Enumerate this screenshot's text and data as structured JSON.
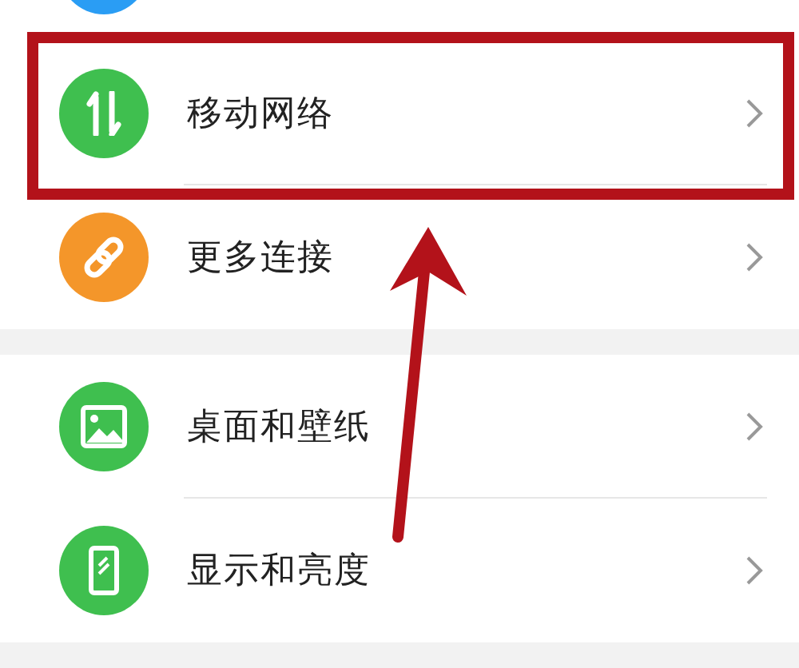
{
  "top_item": {
    "color": "#2a9df4"
  },
  "groups": [
    {
      "items": [
        {
          "kind": "arrows",
          "label": "移动网络",
          "color": "#3fbf4f",
          "highlighted": true
        },
        {
          "kind": "link",
          "label": "更多连接",
          "color": "#f4962a",
          "highlighted": false
        }
      ]
    },
    {
      "items": [
        {
          "kind": "image",
          "label": "桌面和壁纸",
          "color": "#3fbf4f",
          "highlighted": false
        },
        {
          "kind": "phone",
          "label": "显示和亮度",
          "color": "#3fbf4f",
          "highlighted": false
        }
      ]
    }
  ]
}
